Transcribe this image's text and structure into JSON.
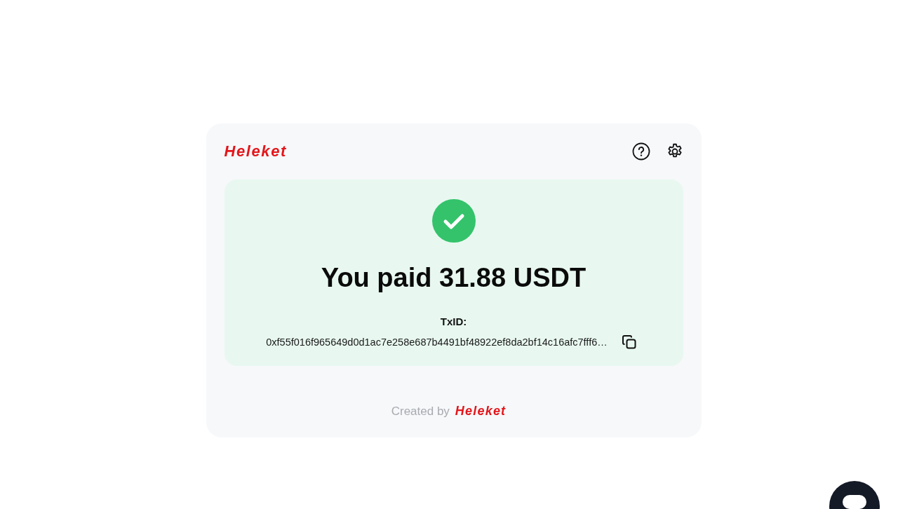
{
  "header": {
    "logo": "Heleket"
  },
  "status": {
    "kind": "success",
    "title": "You paid 31.88 USDT",
    "txid_label": "TxID:",
    "txid": "0xf55f016f965649d0d1ac7e258e687b4491bf48922ef8da2bf14c16afc7fff6…"
  },
  "footer": {
    "created_by": "Created by",
    "logo": "Heleket"
  }
}
